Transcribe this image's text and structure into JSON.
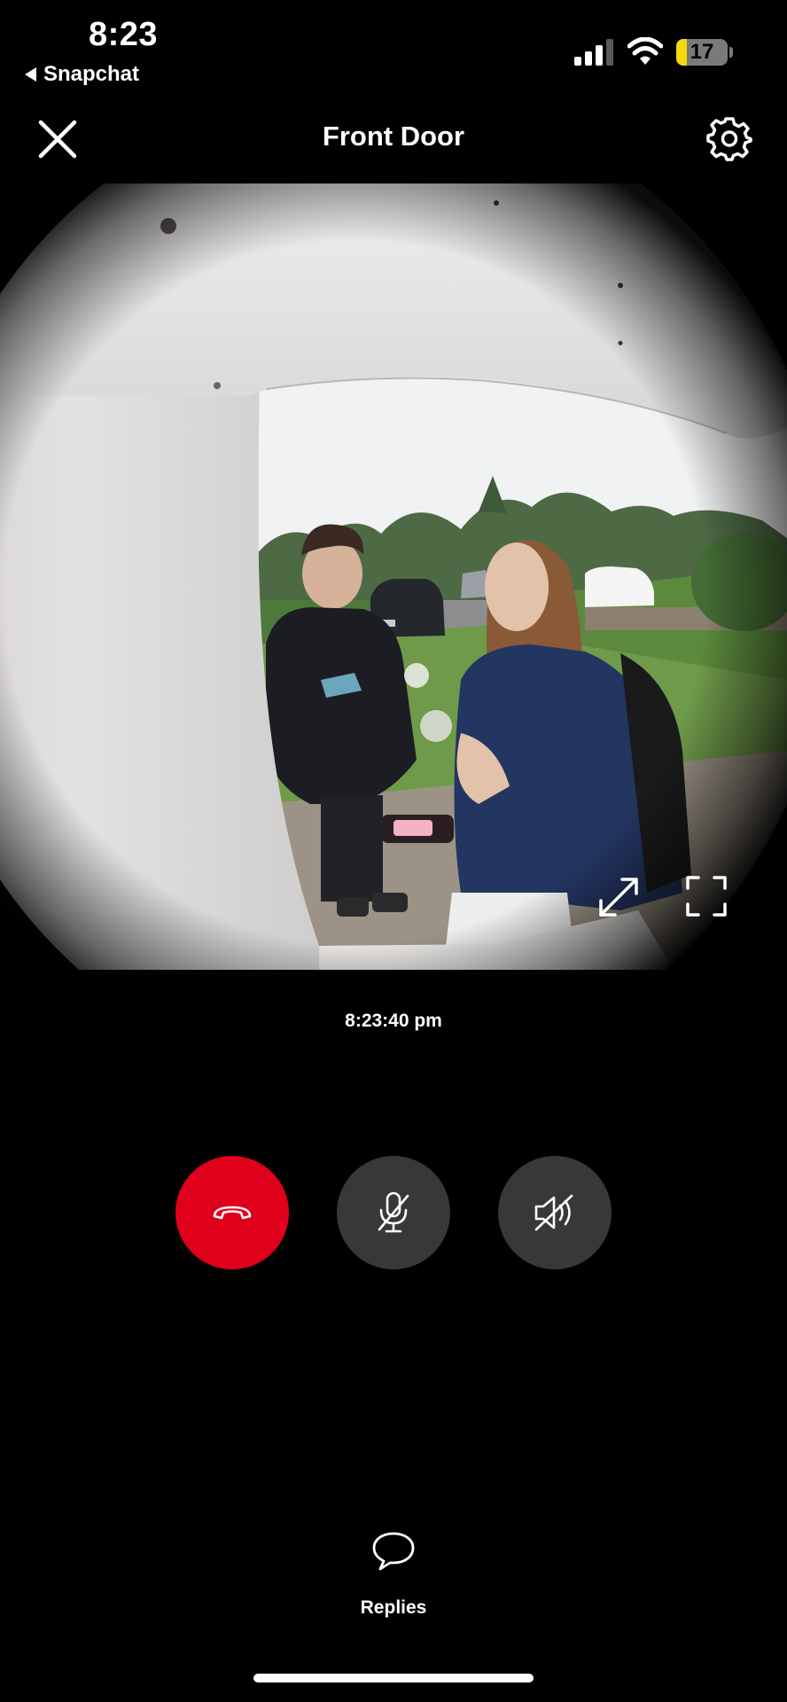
{
  "status_bar": {
    "time": "8:23",
    "back_app": "Snapchat",
    "battery_level": "17",
    "icons": [
      "cellular-signal-icon",
      "wifi-icon",
      "battery-icon"
    ]
  },
  "header": {
    "title": "Front Door",
    "close_icon": "close-icon",
    "settings_icon": "gear-icon"
  },
  "video": {
    "timestamp": "8:23:40 pm",
    "controls": [
      "expand-icon",
      "fullscreen-icon"
    ]
  },
  "call_controls": [
    {
      "name": "hang-up",
      "icon": "phone-hangup-icon",
      "color": "#e0001b"
    },
    {
      "name": "mute-microphone",
      "icon": "microphone-muted-icon",
      "color": "#38383a"
    },
    {
      "name": "mute-speaker",
      "icon": "speaker-muted-icon",
      "color": "#38383a"
    }
  ],
  "replies": {
    "label": "Replies",
    "icon": "speech-bubble-icon"
  }
}
